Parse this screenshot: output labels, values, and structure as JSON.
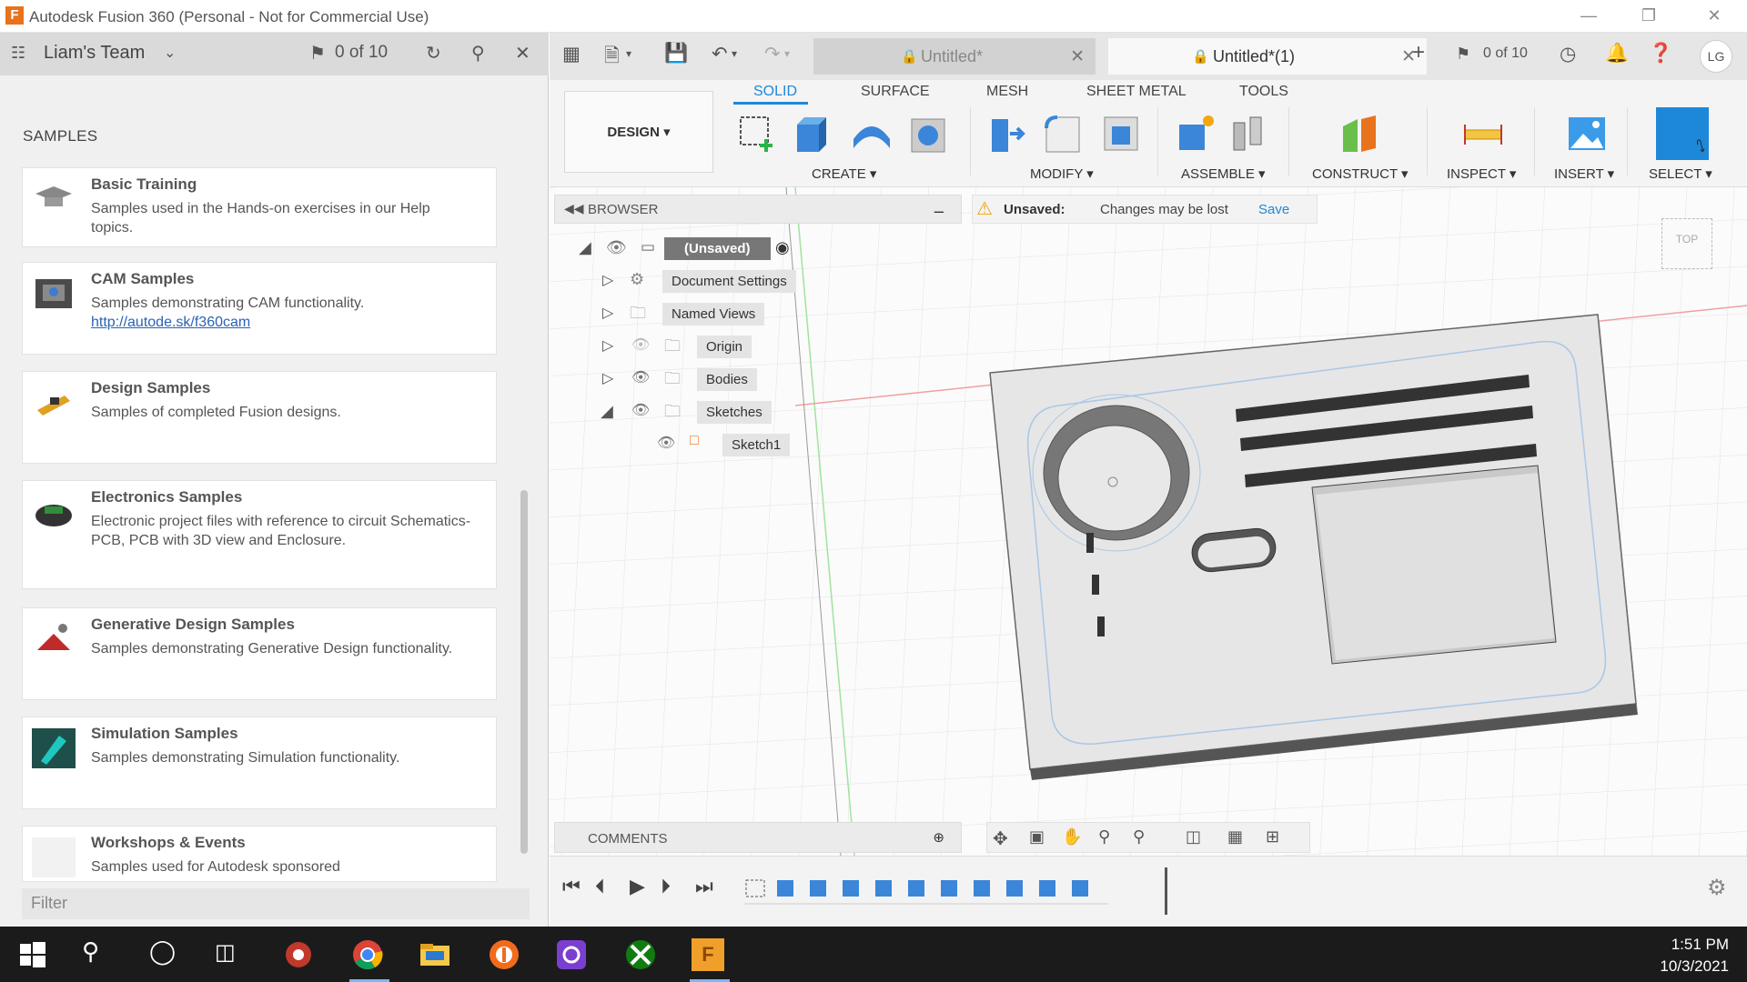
{
  "window": {
    "title": "Autodesk Fusion 360 (Personal - Not for Commercial Use)",
    "app_icon": "F"
  },
  "left_panel": {
    "team": "Liam's Team",
    "counter": "0 of 10",
    "section_title": "SAMPLES",
    "filter_placeholder": "Filter",
    "cards": [
      {
        "title": "Basic Training",
        "desc": "Samples used in the Hands-on exercises in our Help topics.",
        "link": ""
      },
      {
        "title": "CAM Samples",
        "desc": "Samples demonstrating CAM functionality.",
        "link": "http://autode.sk/f360cam"
      },
      {
        "title": "Design Samples",
        "desc": "Samples of completed Fusion designs.",
        "link": ""
      },
      {
        "title": "Electronics Samples",
        "desc": "Electronic project files with reference to circuit Schematics-PCB, PCB with 3D view and Enclosure.",
        "link": ""
      },
      {
        "title": "Generative Design Samples",
        "desc": "Samples demonstrating Generative Design functionality.",
        "link": ""
      },
      {
        "title": "Simulation Samples",
        "desc": "Samples demonstrating Simulation functionality.",
        "link": ""
      },
      {
        "title": "Workshops & Events",
        "desc": "Samples used for Autodesk sponsored",
        "link": ""
      }
    ]
  },
  "tabs": [
    {
      "label": "Untitled*",
      "locked": true
    },
    {
      "label": "Untitled*(1)",
      "locked": true
    }
  ],
  "top_right": {
    "counter": "0 of 10",
    "avatar": "LG"
  },
  "toolbar": {
    "workspace": "DESIGN",
    "tabs": [
      "SOLID",
      "SURFACE",
      "MESH",
      "SHEET METAL",
      "TOOLS"
    ],
    "groups": [
      "CREATE",
      "MODIFY",
      "ASSEMBLE",
      "CONSTRUCT",
      "INSPECT",
      "INSERT",
      "SELECT"
    ]
  },
  "browser": {
    "title": "BROWSER",
    "root": "(Unsaved)",
    "items": [
      "Document Settings",
      "Named Views",
      "Origin",
      "Bodies",
      "Sketches",
      "Sketch1"
    ]
  },
  "warning": {
    "label": "Unsaved:",
    "message": "Changes may be lost",
    "action": "Save"
  },
  "viewcube": {
    "face": "TOP"
  },
  "comments": {
    "title": "COMMENTS"
  },
  "clock": {
    "time": "1:51 PM",
    "date": "10/3/2021"
  },
  "colors": {
    "accent": "#1e88d8",
    "brand": "#e8731c"
  }
}
